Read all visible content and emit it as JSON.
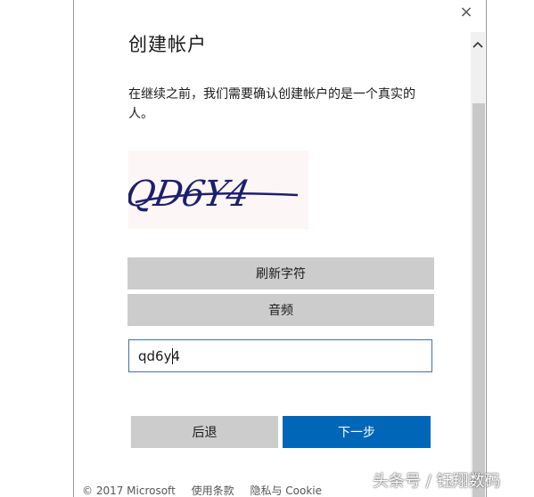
{
  "dialog": {
    "title": "创建帐户",
    "description": "在继续之前，我们需要确认创建帐户的是一个真实的人。",
    "close_symbol": "×"
  },
  "captcha": {
    "text": "QD6Y4",
    "colors": {
      "ink": "#1c1f6e",
      "background": "#fdf6f6"
    }
  },
  "buttons": {
    "refresh_label": "刷新字符",
    "audio_label": "音频",
    "back_label": "后退",
    "next_label": "下一步"
  },
  "answer": {
    "value": "qd6y4",
    "placeholder": ""
  },
  "footer": {
    "copyright": "© 2017 Microsoft",
    "terms_label": "使用条款",
    "privacy_label": "隐私与 Cookie"
  },
  "watermark": {
    "text": "头条号 / 钰翔数码"
  },
  "colors": {
    "accent": "#0067b8",
    "button_gray": "#cccccc",
    "input_border": "#4a6f9a"
  },
  "icons": {
    "close": "close-icon",
    "scroll_up": "chevron-up-icon"
  }
}
